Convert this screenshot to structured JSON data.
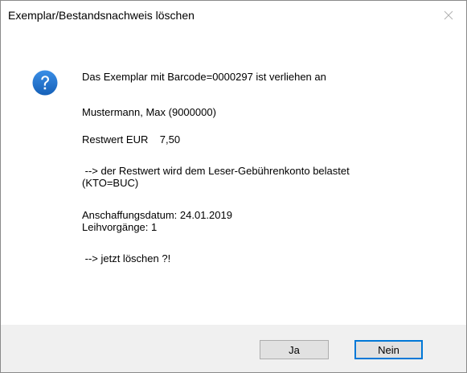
{
  "window": {
    "title": "Exemplar/Bestandsnachweis löschen",
    "close_icon": "close-icon"
  },
  "message": {
    "icon": "question-icon",
    "line1": "Das Exemplar mit Barcode=0000297 ist verliehen an",
    "line2": "Mustermann, Max (9000000)",
    "line3": "Restwert EUR    7,50",
    "line4": " --> der Restwert wird dem Leser-Gebührenkonto belastet",
    "line5": "(KTO=BUC)",
    "line6": "Anschaffungsdatum: 24.01.2019",
    "line7": "Leihvorgänge: 1",
    "line8": " --> jetzt löschen ?!"
  },
  "buttons": {
    "yes_label": "Ja",
    "no_label": "Nein"
  },
  "colors": {
    "icon_blue": "#1c6fc4",
    "focus_border": "#0078d7",
    "footer_bg": "#f0f0f0"
  }
}
